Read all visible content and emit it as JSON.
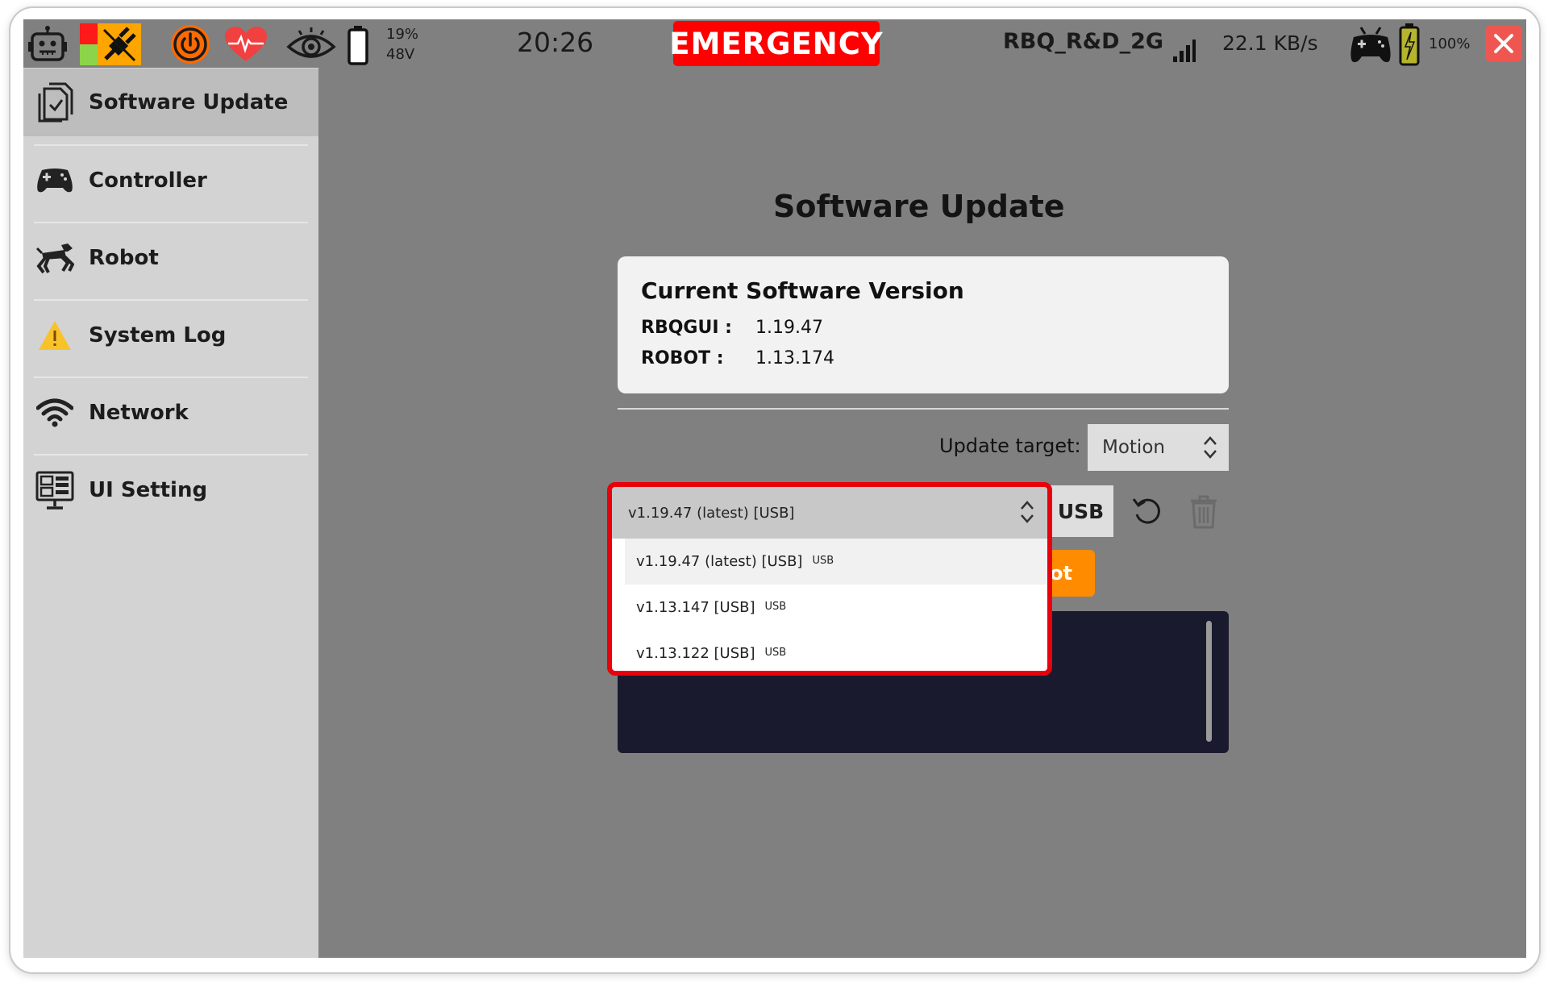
{
  "status_bar": {
    "battery_percent": "19%",
    "battery_voltage": "48V",
    "time": "20:26",
    "emergency_label": "EMERGENCY",
    "wifi_ssid": "RBQ_R&D_2G",
    "transfer_rate": "22.1 KB/s",
    "controller_battery": "100%"
  },
  "sidebar": {
    "items": [
      {
        "label": "Software Update",
        "icon": "software-update-icon",
        "active": true
      },
      {
        "label": "Controller",
        "icon": "gamepad-icon"
      },
      {
        "label": "Robot",
        "icon": "robot-dog-icon"
      },
      {
        "label": "System Log",
        "icon": "warning-icon"
      },
      {
        "label": "Network",
        "icon": "wifi-icon"
      },
      {
        "label": "UI Setting",
        "icon": "monitor-settings-icon"
      }
    ]
  },
  "main": {
    "title": "Software Update",
    "version_card": {
      "title": "Current Software Version",
      "rows": [
        {
          "key": "RBQGUI :",
          "value": "1.19.47"
        },
        {
          "key": "ROBOT :",
          "value": "1.13.174"
        }
      ]
    },
    "update_target": {
      "label": "Update target:",
      "value": "Motion"
    },
    "usb_button_label": "USB",
    "orange_button_label": "ot",
    "version_select": {
      "selected": "v1.19.47 (latest) [USB]",
      "options": [
        {
          "label": "v1.19.47 (latest) [USB]",
          "tag": "USB"
        },
        {
          "label": "v1.13.147 [USB]",
          "tag": "USB"
        },
        {
          "label": "v1.13.122 [USB]",
          "tag": "USB"
        }
      ]
    }
  },
  "colors": {
    "emergency": "#ff0000",
    "highlight_border": "#e8000b",
    "close": "#f05650",
    "power": "#ff6a00",
    "orange_button": "#ff8c00",
    "log_panel": "#1a1a2e"
  }
}
